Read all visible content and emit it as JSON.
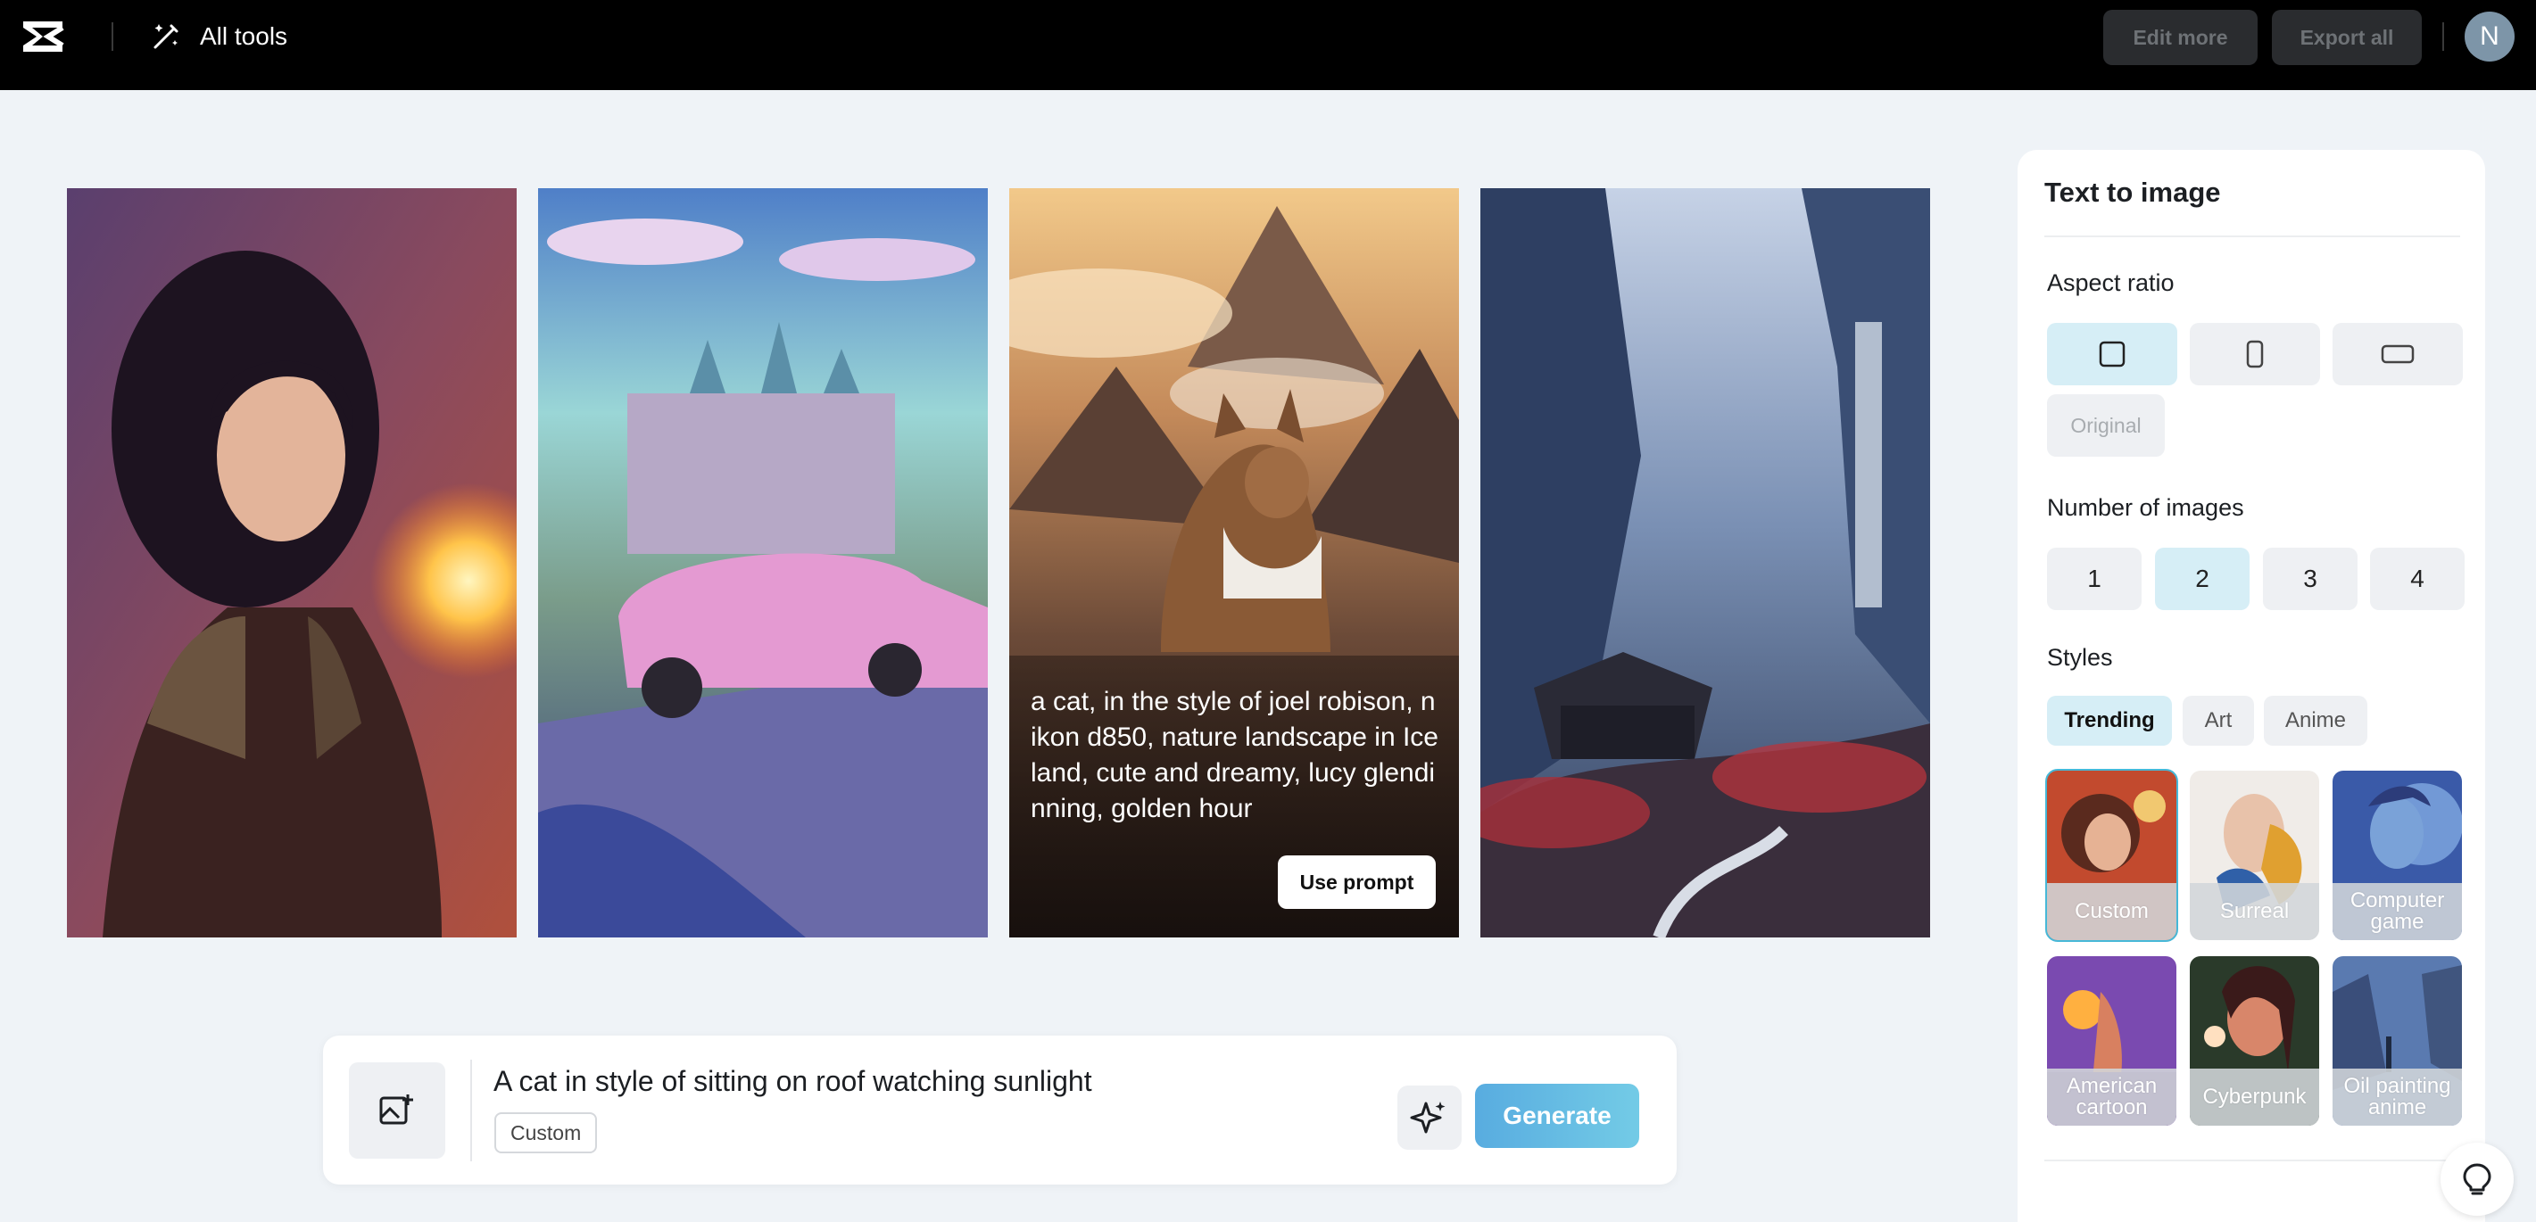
{
  "topbar": {
    "logo": "capcut-logo",
    "all_tools_label": "All tools",
    "edit_more_label": "Edit more",
    "export_all_label": "Export all",
    "avatar_initial": "N"
  },
  "gallery": {
    "images": [
      {
        "subject": "warrior-woman-with-fireball"
      },
      {
        "subject": "pink-car-and-castle"
      },
      {
        "subject": "cat-mountain-landscape",
        "prompt": "a cat, in the style of joel robison, nikon d850, nature landscape in Iceland, cute and dreamy, lucy glendinning, golden hour",
        "use_prompt_label": "Use prompt"
      },
      {
        "subject": "misty-valley-temple"
      }
    ]
  },
  "prompt_bar": {
    "text": "A cat in style of sitting on roof watching sunlight",
    "style_chip": "Custom",
    "generate_label": "Generate"
  },
  "panel": {
    "title": "Text to image",
    "aspect_ratio": {
      "label": "Aspect ratio",
      "options": [
        "square",
        "portrait",
        "landscape"
      ],
      "selected": "square",
      "original_label": "Original"
    },
    "number_of_images": {
      "label": "Number of images",
      "options": [
        "1",
        "2",
        "3",
        "4"
      ],
      "selected": "2"
    },
    "styles": {
      "label": "Styles",
      "tabs": [
        "Trending",
        "Art",
        "Anime"
      ],
      "selected_tab": "Trending",
      "cards": [
        "Custom",
        "Surreal",
        "Computer game",
        "American cartoon",
        "Cyberpunk",
        "Oil painting anime"
      ],
      "selected_card": "Custom"
    }
  },
  "colors": {
    "accent": "#46b8d8",
    "selected_bg": "#d6eef6",
    "generate_gradient_start": "#58ace0",
    "generate_gradient_end": "#73cbe6",
    "topbar_bg": "#000000",
    "page_bg": "#eff3f7"
  }
}
